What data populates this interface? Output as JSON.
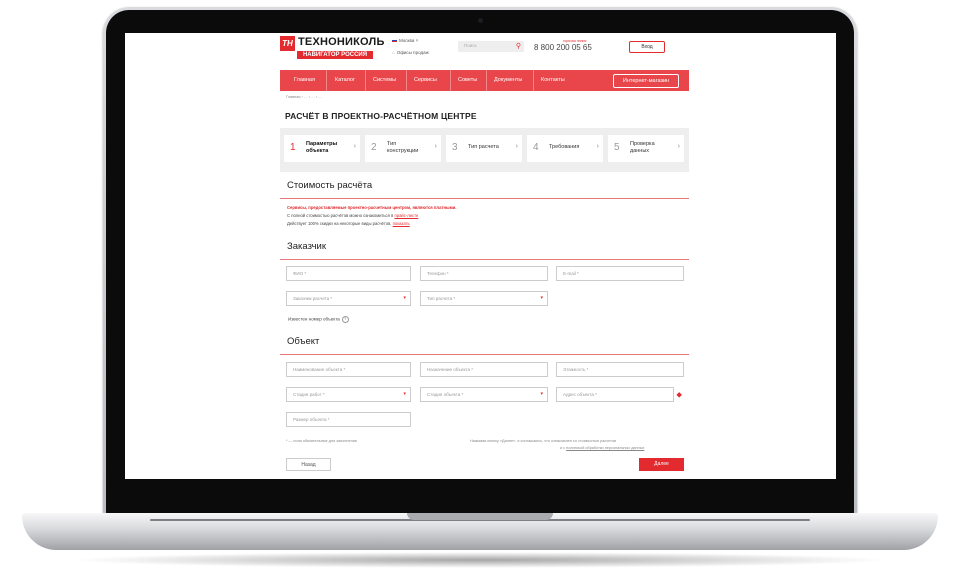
{
  "logo": {
    "mark": "ТН",
    "name": "ТЕХНОНИКОЛЬ",
    "tagline": "НАВИГАТОР РОССИЯ"
  },
  "header": {
    "region": "Москва ˅",
    "office": "Офисы продаж",
    "search_placeholder": "Поиск",
    "phone_note": "горячая линия",
    "phone": "8 800 200 05 65",
    "login": "Вход"
  },
  "nav": {
    "items": [
      "Главная",
      "Каталог",
      "Системы",
      "Сервисы",
      "Советы",
      "Документы",
      "Контакты"
    ],
    "shop": "Интернет-магазин"
  },
  "breadcrumbs": "Главная › … › … › …",
  "page_title": "РАСЧЁТ В ПРОЕКТНО-РАСЧЁТНОМ ЦЕНТРЕ",
  "steps": [
    {
      "num": "1",
      "label": [
        "Параметры",
        "объекта"
      ],
      "active": true
    },
    {
      "num": "2",
      "label": [
        "Тип",
        "конструкции"
      ],
      "active": false
    },
    {
      "num": "3",
      "label": [
        "Тип расчета"
      ],
      "active": false
    },
    {
      "num": "4",
      "label": [
        "Требования"
      ],
      "active": false
    },
    {
      "num": "5",
      "label": [
        "Проверка",
        "данных"
      ],
      "active": false
    }
  ],
  "cost": {
    "heading": "Стоимость расчёта",
    "line1": "Сервисы, предоставляемые проектно-расчетным центром, являются платными.",
    "line2_text": "С полной стоимостью расчётов можно ознакомиться в ",
    "line2_link": "прайс-листе",
    "line3_text": "Действует 100% скидки на некоторые виды расчётов, ",
    "line3_link": "показать"
  },
  "customer": {
    "heading": "Заказчик",
    "fields": [
      "ФИО *",
      "Телефон *",
      "E-mail *"
    ],
    "selects": [
      "Заказчик расчета *",
      "Тип расчета *"
    ],
    "known_number": "Известен номер объекта"
  },
  "object": {
    "heading": "Объект",
    "fields": [
      "Наименование объекта *",
      "Назначение объекта *",
      "Этажность *"
    ],
    "selects": [
      "Стадия работ *",
      "Стадия объекта *"
    ],
    "address": "Адрес объекта *",
    "area": "Размер объекта *"
  },
  "footer": {
    "required_note": "* — поля обязательные для заполнения",
    "consent_line1": "Нажимая кнопку «Далее», я соглашаюсь, что ознакомлен со стоимостью расчетов",
    "consent_line2_text": "и с ",
    "consent_line2_link": "политикой обработки персональных данных",
    "back": "Назад",
    "next": "Далее"
  },
  "colors": {
    "accent": "#e32b2f",
    "nav": "#e8464a",
    "rule": "#e9787b"
  }
}
